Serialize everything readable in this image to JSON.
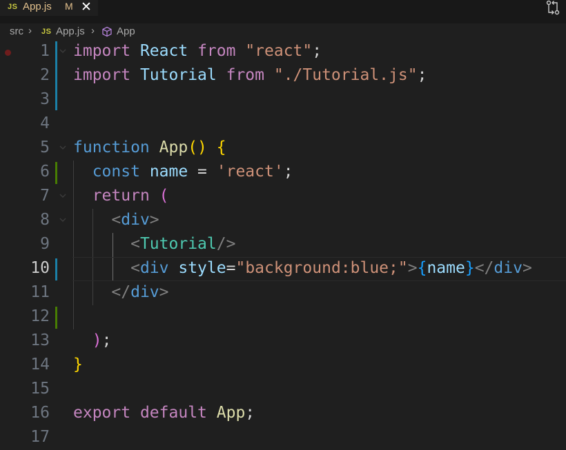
{
  "tab": {
    "icon": "JS",
    "title": "App.js",
    "status": "M",
    "close_icon": "close-icon"
  },
  "toolbar": {
    "compare_icon": "compare-changes-icon"
  },
  "breadcrumb": {
    "folder": "src",
    "file_icon": "JS",
    "file": "App.js",
    "symbol_icon": "symbol-cube-icon",
    "symbol": "App"
  },
  "colors": {
    "keyword": "#c586c0",
    "storage": "#569cd6",
    "function": "#dcdcaa",
    "variable": "#9cdcfe",
    "component": "#4ec9b0",
    "string": "#ce9178",
    "modified_gutter": "#1b81a8",
    "added_gutter": "#487e02"
  },
  "editor": {
    "current_line": 10,
    "lines": [
      {
        "n": "1",
        "t": [
          [
            "kw",
            "import"
          ],
          [
            "pun",
            " "
          ],
          [
            "var",
            "React"
          ],
          [
            "pun",
            " "
          ],
          [
            "kw",
            "from"
          ],
          [
            "pun",
            " "
          ],
          [
            "str",
            "\"react\""
          ],
          [
            "pun",
            ";"
          ]
        ]
      },
      {
        "n": "2",
        "t": [
          [
            "kw",
            "import"
          ],
          [
            "pun",
            " "
          ],
          [
            "var",
            "Tutorial"
          ],
          [
            "pun",
            " "
          ],
          [
            "kw",
            "from"
          ],
          [
            "pun",
            " "
          ],
          [
            "str",
            "\"./Tutorial.js\""
          ],
          [
            "pun",
            ";"
          ]
        ]
      },
      {
        "n": "3",
        "t": []
      },
      {
        "n": "4",
        "t": []
      },
      {
        "n": "5",
        "t": [
          [
            "st",
            "function"
          ],
          [
            "pun",
            " "
          ],
          [
            "fn",
            "App"
          ],
          [
            "br1",
            "()"
          ],
          [
            "pun",
            " "
          ],
          [
            "br1",
            "{"
          ]
        ]
      },
      {
        "n": "6",
        "t": [
          [
            "pun",
            "  "
          ],
          [
            "st",
            "const"
          ],
          [
            "pun",
            " "
          ],
          [
            "var",
            "name"
          ],
          [
            "pun",
            " = "
          ],
          [
            "str",
            "'react'"
          ],
          [
            "pun",
            ";"
          ]
        ]
      },
      {
        "n": "7",
        "t": [
          [
            "pun",
            "  "
          ],
          [
            "kw",
            "return"
          ],
          [
            "pun",
            " "
          ],
          [
            "br2",
            "("
          ]
        ]
      },
      {
        "n": "8",
        "t": [
          [
            "pun",
            "    "
          ],
          [
            "tag",
            "<"
          ],
          [
            "tname",
            "div"
          ],
          [
            "tag",
            ">"
          ]
        ]
      },
      {
        "n": "9",
        "t": [
          [
            "pun",
            "      "
          ],
          [
            "tag",
            "<"
          ],
          [
            "cls",
            "Tutorial"
          ],
          [
            "tag",
            "/>"
          ]
        ]
      },
      {
        "n": "10",
        "t": [
          [
            "pun",
            "      "
          ],
          [
            "tag",
            "<"
          ],
          [
            "tname",
            "div"
          ],
          [
            "pun",
            " "
          ],
          [
            "var",
            "style"
          ],
          [
            "pun",
            "="
          ],
          [
            "str",
            "\"background:blue;\""
          ],
          [
            "tag",
            ">"
          ],
          [
            "br3",
            "{"
          ],
          [
            "var",
            "name"
          ],
          [
            "br3",
            "}"
          ],
          [
            "tag",
            "</"
          ],
          [
            "tname",
            "div"
          ],
          [
            "tag",
            ">"
          ]
        ]
      },
      {
        "n": "11",
        "t": [
          [
            "pun",
            "    "
          ],
          [
            "tag",
            "</"
          ],
          [
            "tname",
            "div"
          ],
          [
            "tag",
            ">"
          ]
        ]
      },
      {
        "n": "12",
        "t": []
      },
      {
        "n": "13",
        "t": [
          [
            "pun",
            "  "
          ],
          [
            "br2",
            ")"
          ],
          [
            "pun",
            ";"
          ]
        ]
      },
      {
        "n": "14",
        "t": [
          [
            "br1",
            "}"
          ]
        ]
      },
      {
        "n": "15",
        "t": []
      },
      {
        "n": "16",
        "t": [
          [
            "kw",
            "export"
          ],
          [
            "pun",
            " "
          ],
          [
            "kw",
            "default"
          ],
          [
            "pun",
            " "
          ],
          [
            "fn",
            "App"
          ],
          [
            "pun",
            ";"
          ]
        ]
      },
      {
        "n": "17",
        "t": []
      }
    ]
  }
}
